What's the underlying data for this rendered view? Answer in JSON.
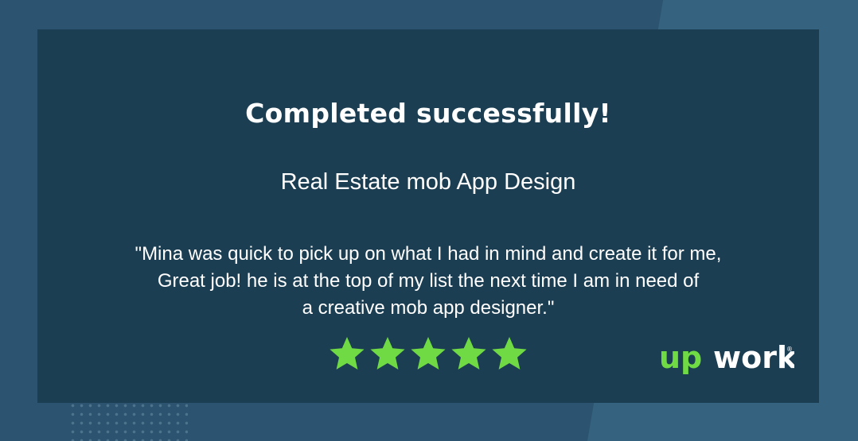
{
  "colors": {
    "background": "#2c5470",
    "card": "#1c3e52",
    "text": "#ffffff",
    "star": "#6fda44",
    "brand_green": "#6fda44"
  },
  "card": {
    "title": "Completed successfully!",
    "subtitle": "Real Estate mob App Design",
    "quote_lines": [
      "\"Mina was quick to pick up on what I had in mind and create it for me,",
      "Great job! he is at the top of my list the next time I am in need of",
      "a creative mob app designer.\""
    ],
    "rating": {
      "stars": 5,
      "max": 5,
      "icon": "star-icon"
    }
  },
  "brand": {
    "logo_text_up": "up",
    "logo_text_work": "work",
    "logo_mark": "®"
  }
}
